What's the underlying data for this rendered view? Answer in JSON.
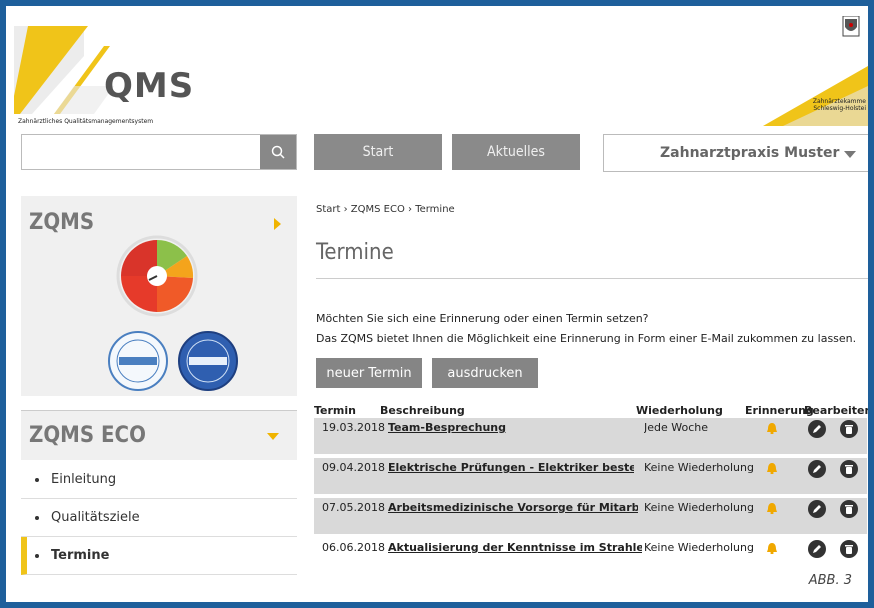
{
  "header": {
    "logo_title": "QMS",
    "logo_subtitle": "Zahnärztliches Qualitätsmanagementsystem",
    "chamber_lines": [
      "Zahnärztekamme",
      "Schleswig-Holstei"
    ]
  },
  "search": {
    "placeholder": "",
    "value": ""
  },
  "nav": {
    "start": "Start",
    "aktuelles": "Aktuelles",
    "practice_select": "Zahnarztpraxis Muster"
  },
  "sidebar": {
    "zqms_title": "ZQMS",
    "eco_title": "ZQMS ECO",
    "items": [
      {
        "label": "Einleitung"
      },
      {
        "label": "Qualitätsziele"
      },
      {
        "label": "Termine"
      }
    ]
  },
  "breadcrumb": "Start › ZQMS ECO › Termine",
  "page": {
    "title": "Termine",
    "intro_line1": "Möchten Sie sich eine Erinnerung oder einen Termin setzen?",
    "intro_line2": "Das ZQMS bietet Ihnen die Möglichkeit eine Erinnerung in Form einer E-Mail zukommen zu lassen.",
    "new_button": "neuer Termin",
    "print_button": "ausdrucken"
  },
  "table": {
    "headers": {
      "termin": "Termin",
      "beschreibung": "Beschreibung",
      "wiederholung": "Wiederholung",
      "erinnerung": "Erinnerung",
      "bearbeiten": "Bearbeiten"
    },
    "rows": [
      {
        "date": "19.03.2018",
        "description": "Team-Besprechung",
        "repeat": "Jede Woche"
      },
      {
        "date": "09.04.2018",
        "description": "Elektrische Prüfungen - Elektriker bestellen",
        "repeat": "Keine Wiederholung"
      },
      {
        "date": "07.05.2018",
        "description": "Arbeitsmedizinische Vorsorge für Mitarbeiterinnen",
        "repeat": "Keine Wiederholung"
      },
      {
        "date": "06.06.2018",
        "description": "Aktualisierung der Kenntnisse im Strahlenschutz f...",
        "repeat": "Keine Wiederholung"
      }
    ]
  },
  "figure_label": "ABB. 3",
  "colors": {
    "accent": "#f0c419",
    "bell": "#f0a800",
    "frame": "#1e5f9b",
    "button": "#8a8a8a"
  }
}
